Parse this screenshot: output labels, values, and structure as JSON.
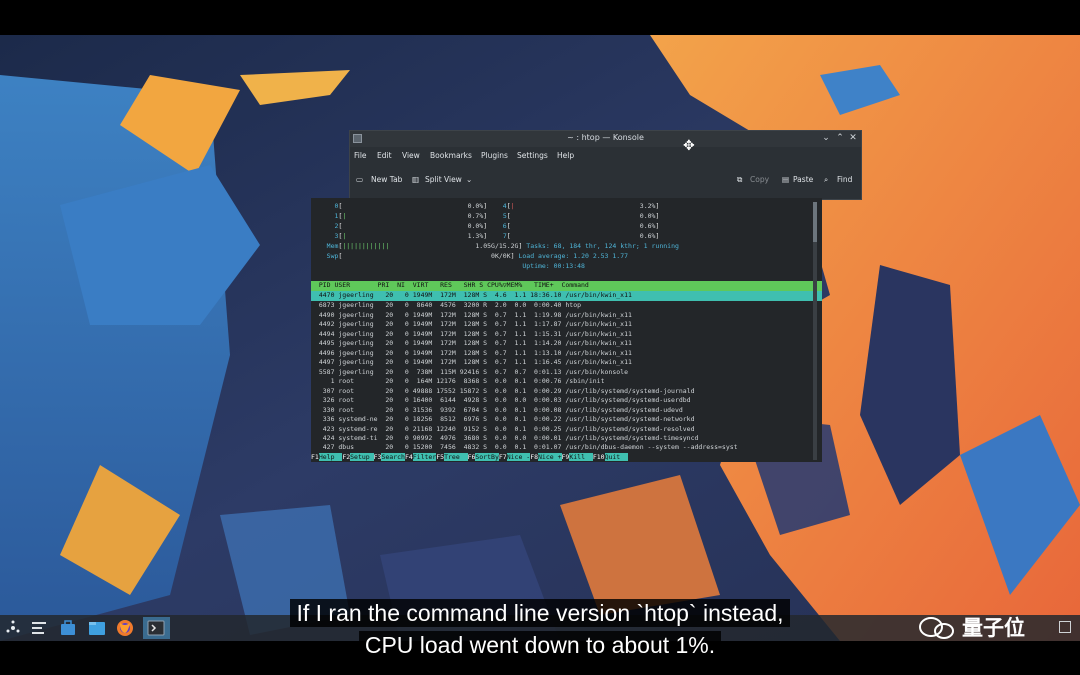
{
  "konsole": {
    "title": "~ : htop — Konsole",
    "menu": [
      "File",
      "Edit",
      "View",
      "Bookmarks",
      "Plugins",
      "Settings",
      "Help"
    ],
    "toolbar": {
      "new_tab": "New Tab",
      "split_view": "Split View",
      "copy": "Copy",
      "paste": "Paste",
      "find": "Find"
    },
    "window_controls": {
      "minimize": "⌄",
      "maximize": "⌃",
      "close": "✕"
    }
  },
  "htop": {
    "cpu_meters": [
      {
        "label": "0",
        "value": "0.0%"
      },
      {
        "label": "1",
        "value": "0.7%"
      },
      {
        "label": "2",
        "value": "0.0%"
      },
      {
        "label": "3",
        "value": "1.3%"
      },
      {
        "label": "4",
        "value": "3.2%"
      },
      {
        "label": "5",
        "value": "0.0%"
      },
      {
        "label": "6",
        "value": "0.6%"
      },
      {
        "label": "7",
        "value": "0.6%"
      }
    ],
    "mem": {
      "label": "Mem",
      "bar": "||||||||||||",
      "value": "1.05G/15.2G"
    },
    "swp": {
      "label": "Swp",
      "value": "0K/0K"
    },
    "tasks": "Tasks: 68, 184 thr, 124 kthr; 1 running",
    "load": "Load average: 1.20 2.53 1.77",
    "uptime": "Uptime: 00:13:48",
    "header": "  PID USER       PRI  NI  VIRT   RES   SHR S CPU%▽MEM%   TIME+  Command",
    "rows": [
      "  4470 jgeerling   20   0 1949M  172M  128M S  4.6  1.1 18:36.10 /usr/bin/kwin_x11",
      "  6873 jgeerling   20   0  8640  4576  3200 R  2.0  0.0  0:00.40 htop",
      "  4490 jgeerling   20   0 1949M  172M  128M S  0.7  1.1  1:19.98 /usr/bin/kwin_x11",
      "  4492 jgeerling   20   0 1949M  172M  128M S  0.7  1.1  1:17.87 /usr/bin/kwin_x11",
      "  4494 jgeerling   20   0 1949M  172M  128M S  0.7  1.1  1:15.31 /usr/bin/kwin_x11",
      "  4495 jgeerling   20   0 1949M  172M  128M S  0.7  1.1  1:14.20 /usr/bin/kwin_x11",
      "  4496 jgeerling   20   0 1949M  172M  128M S  0.7  1.1  1:13.10 /usr/bin/kwin_x11",
      "  4497 jgeerling   20   0 1949M  172M  128M S  0.7  1.1  1:16.45 /usr/bin/kwin_x11",
      "  5587 jgeerling   20   0  738M  115M 92416 S  0.7  0.7  0:01.13 /usr/bin/konsole",
      "     1 root        20   0  164M 12176  8368 S  0.0  0.1  0:00.76 /sbin/init",
      "   307 root        20   0 49888 17552 15872 S  0.0  0.1  0:00.29 /usr/lib/systemd/systemd-journald",
      "   326 root        20   0 16400  6144  4928 S  0.0  0.0  0:00.03 /usr/lib/systemd/systemd-userdbd",
      "   330 root        20   0 31536  9392  6704 S  0.0  0.1  0:00.08 /usr/lib/systemd/systemd-udevd",
      "   336 systemd-ne  20   0 18256  8512  6976 S  0.0  0.1  0:00.22 /usr/lib/systemd/systemd-networkd",
      "   423 systemd-re  20   0 21168 12240  9152 S  0.0  0.1  0:00.25 /usr/lib/systemd/systemd-resolved",
      "   424 systemd-ti  20   0 90992  4976  3680 S  0.0  0.0  0:00.01 /usr/lib/systemd/systemd-timesyncd",
      "   427 dbus        20   0 15200  7456  4832 S  0.0  0.1  0:01.07 /usr/bin/dbus-daemon --system --address=syst"
    ],
    "fkeys": [
      {
        "key": "F1",
        "label": "Help  "
      },
      {
        "key": "F2",
        "label": "Setup "
      },
      {
        "key": "F3",
        "label": "Search"
      },
      {
        "key": "F4",
        "label": "Filter"
      },
      {
        "key": "F5",
        "label": "Tree  "
      },
      {
        "key": "F6",
        "label": "SortBy"
      },
      {
        "key": "F7",
        "label": "Nice -"
      },
      {
        "key": "F8",
        "label": "Nice +"
      },
      {
        "key": "F9",
        "label": "Kill  "
      },
      {
        "key": "F10",
        "label": "Quit  "
      }
    ]
  },
  "taskbar": {
    "icons": [
      "launcher-icon",
      "task-manager-icon",
      "store-icon",
      "file-manager-icon",
      "firefox-icon",
      "konsole-icon"
    ]
  },
  "subtitle": {
    "line1": "If I ran the command line version `htop` instead,",
    "line2": "CPU load went down to about 1%."
  },
  "watermark": "量子位",
  "colors": {
    "accent": "#3fbfb0",
    "header": "#5fc85a",
    "terminal_bg": "#232629"
  }
}
